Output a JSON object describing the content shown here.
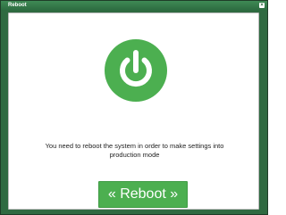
{
  "dialog": {
    "title": "Reboot",
    "close_label": "×"
  },
  "content": {
    "icon": "power-icon",
    "message_line1": "You need to reboot the system in order to make settings into",
    "message_line2": "production mode",
    "button_label": "« Reboot »"
  },
  "colors": {
    "accent": "#4caf50",
    "titlebar": "#2f6a41",
    "text": "#222222",
    "background": "#ffffff"
  }
}
